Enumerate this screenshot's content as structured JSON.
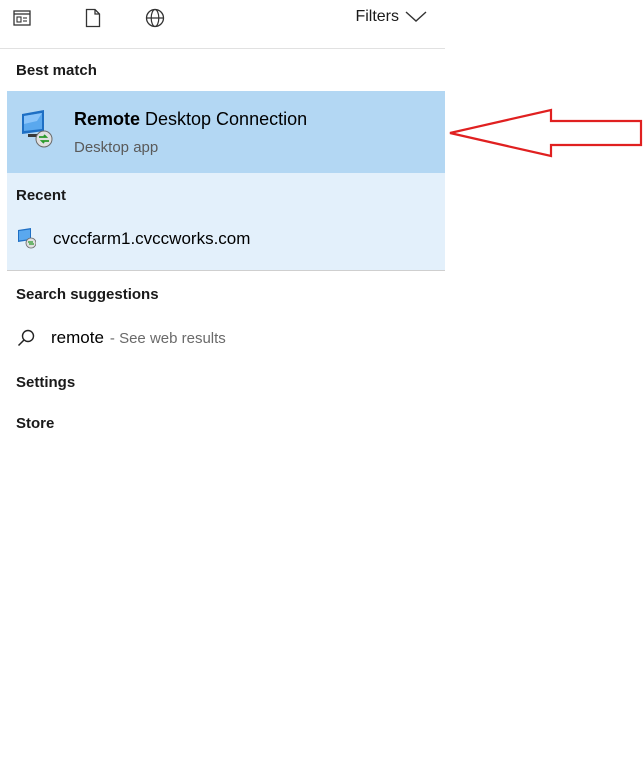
{
  "toolbar": {
    "filters_label": "Filters",
    "icons": [
      "document-view-icon",
      "page-icon",
      "globe-icon"
    ]
  },
  "best_match": {
    "header": "Best match",
    "title_bold": "Remote",
    "title_rest": " Desktop Connection",
    "subtitle": "Desktop app"
  },
  "recent": {
    "header": "Recent",
    "items": [
      "cvccfarm1.cvccworks.com"
    ]
  },
  "suggestions": {
    "header": "Search suggestions",
    "term": "remote",
    "hint": "- See web results"
  },
  "sections": {
    "settings": "Settings",
    "store": "Store"
  },
  "colors": {
    "selected_bg": "#b3d7f3",
    "recent_bg": "#e3f0fb",
    "arrow": "#e02020"
  }
}
